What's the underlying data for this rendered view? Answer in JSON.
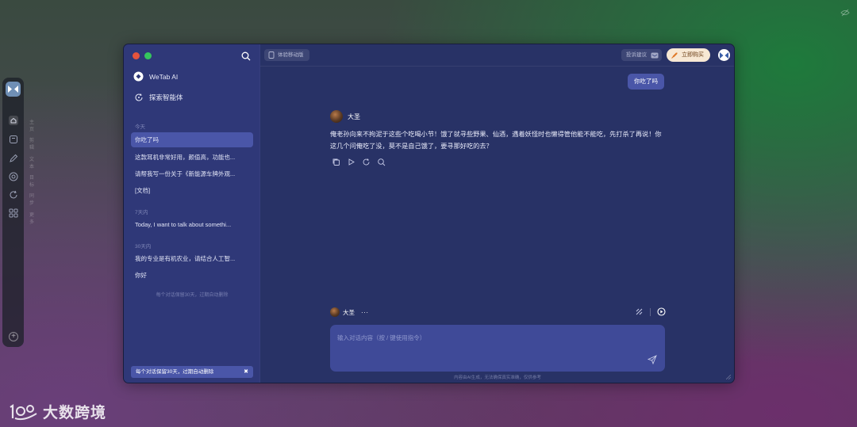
{
  "app": {
    "name": "WeTab AI"
  },
  "dock": {
    "items": [
      {
        "icon": "home-icon",
        "label": "主页"
      },
      {
        "icon": "bookmark-icon",
        "label": "剪辑"
      },
      {
        "icon": "edit-icon",
        "label": "文本"
      },
      {
        "icon": "target-icon",
        "label": "目标"
      },
      {
        "icon": "refresh-icon",
        "label": "同步"
      },
      {
        "icon": "grid-icon",
        "label": "更多"
      }
    ]
  },
  "sidebar": {
    "nav": [
      {
        "icon": "wetab-logo-icon",
        "label": "WeTab AI"
      },
      {
        "icon": "explore-icon",
        "label": "探索智能体"
      }
    ],
    "groups": [
      {
        "label": "今天",
        "items": [
          "你吃了吗",
          "这款耳机非常好用，颜值高，功能也...",
          "请帮我写一份关于《新能源车牌外观...",
          "[文档]"
        ]
      },
      {
        "label": "7天内",
        "items": [
          "Today, I want to talk about somethi..."
        ]
      },
      {
        "label": "30天内",
        "items": [
          "我的专业是有机农业，请结合人工智...",
          "你好"
        ]
      }
    ],
    "note": "每个对话保留30天，过期自动删除",
    "banner": "每个对话保留30天，过期自动删除"
  },
  "topbar": {
    "mobile_label": "体验移动版",
    "feedback_label": "投诉建议",
    "buy_label": "立即购买"
  },
  "chat": {
    "user_message": "你吃了吗",
    "bot_name": "大圣",
    "bot_message": "俺老孙向来不拘泥于这些个吃喝小节！饿了就寻些野果、仙酒，遇着妖怪时也懒得管他能不能吃，先打杀了再说！你这几个问俺吃了没，莫不是自己饿了，要寻那好吃的去？",
    "actions": [
      "copy-icon",
      "play-icon",
      "regenerate-icon",
      "search-icon"
    ]
  },
  "composer": {
    "agent_name": "大圣",
    "more": "···",
    "placeholder": "输入对话内容（按 / 键使用指令）",
    "disclaimer": "内容由AI生成，无法确保真实准确，仅供参考"
  },
  "watermark": {
    "text": "大数跨境"
  },
  "colors": {
    "window_bg": "#283266",
    "sidebar_bg": "#2f3878",
    "active_item": "#4a56a8",
    "composer_bg": "#3f4a98",
    "buy_button": "#f7e8d4"
  }
}
